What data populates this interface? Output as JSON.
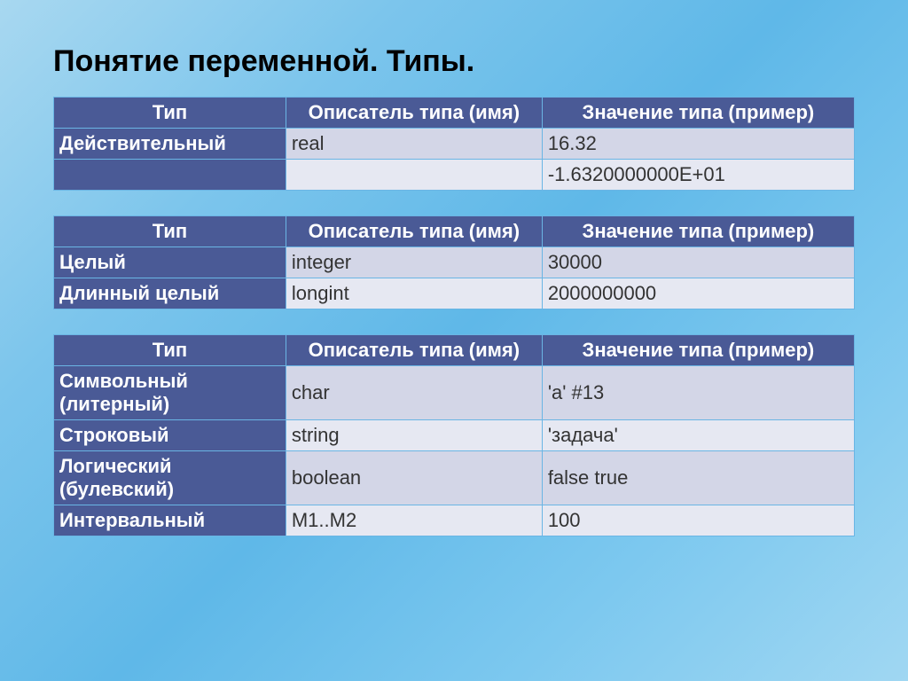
{
  "title": "Понятие переменной. Типы.",
  "headers": {
    "type": "Тип",
    "descriptor": "Описатель типа (имя)",
    "example": "Значение типа (пример)"
  },
  "table1": {
    "rows": [
      {
        "type": "Действительный",
        "descriptor": "real",
        "example": "16.32"
      },
      {
        "type": "",
        "descriptor": "",
        "example": "-1.6320000000Е+01"
      }
    ]
  },
  "table2": {
    "rows": [
      {
        "type": "Целый",
        "descriptor": "integer",
        "example": "30000"
      },
      {
        "type": "Длинный целый",
        "descriptor": "longint",
        "example": "2000000000"
      }
    ]
  },
  "table3": {
    "rows": [
      {
        "type": "Символьный (литерный)",
        "descriptor": "char",
        "example": "'a' #13"
      },
      {
        "type": "Строковый",
        "descriptor": "string",
        "example": "'задача'"
      },
      {
        "type": "Логический (булевский)",
        "descriptor": "boolean",
        "example": "false true"
      },
      {
        "type": "Интервальный",
        "descriptor": "M1..M2",
        "example": "100"
      }
    ]
  }
}
